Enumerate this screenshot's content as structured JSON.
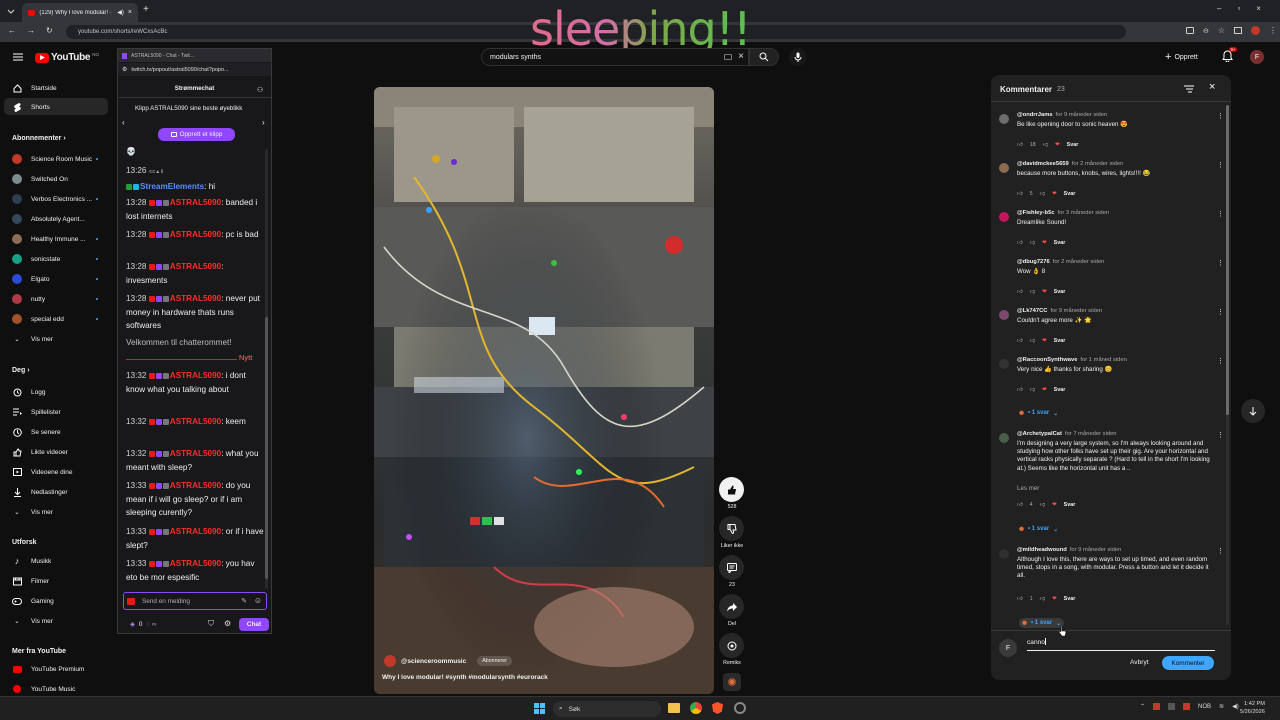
{
  "browser": {
    "tab_title": "(129) Why I love modular! ·",
    "url": "youtube.com/shorts/reWCxsAcBc"
  },
  "overlay_text": "sleeping!!",
  "yt": {
    "logo_text": "YouTube",
    "logo_region": "NO",
    "search_value": "modulars synths",
    "create_label": "Opprett",
    "notification_count": "9+",
    "user_initial": "F"
  },
  "sidebar": {
    "main": [
      {
        "label": "Startside"
      },
      {
        "label": "Shorts"
      }
    ],
    "subs_header": "Abonnementer",
    "subs": [
      {
        "label": "Science Room Music",
        "color": "#c0392b"
      },
      {
        "label": "Switched On",
        "color": "#7f8c8d"
      },
      {
        "label": "Verbos Electronics ...",
        "color": "#2c3e50"
      },
      {
        "label": "Absolutely Agent...",
        "color": "#34495e"
      },
      {
        "label": "Healthy Immune ...",
        "color": "#8e6e53"
      },
      {
        "label": "sonicstate",
        "color": "#16a085"
      },
      {
        "label": "Elgato",
        "color": "#2d4bd8"
      },
      {
        "label": "nutty",
        "color": "#b03a48"
      },
      {
        "label": "special edd",
        "color": "#a0522d"
      }
    ],
    "subs_more": "Vis mer",
    "you_header": "Deg",
    "you": [
      {
        "label": "Logg",
        "icon": "history-icon"
      },
      {
        "label": "Spillelister",
        "icon": "playlist-icon"
      },
      {
        "label": "Se senere",
        "icon": "clock-icon"
      },
      {
        "label": "Likte videoer",
        "icon": "like-icon"
      },
      {
        "label": "Videoene dine",
        "icon": "video-icon"
      },
      {
        "label": "Nedlastinger",
        "icon": "download-icon"
      }
    ],
    "you_more": "Vis mer",
    "explore_header": "Utforsk",
    "explore": [
      {
        "label": "Musikk",
        "icon": "music-icon"
      },
      {
        "label": "Filmer",
        "icon": "film-icon"
      },
      {
        "label": "Gaming",
        "icon": "gaming-icon"
      }
    ],
    "explore_more": "Vis mer",
    "more_header": "Mer fra YouTube",
    "more": [
      {
        "label": "YouTube Premium"
      },
      {
        "label": "YouTube Music"
      }
    ]
  },
  "twitch": {
    "window_title": "ASTRAL5090 - Chat - Twit...",
    "url": "twitch.tv/popout/astral5090/chat?popo...",
    "header": "Strømmechat",
    "clip_text": "Klipp ASTRAL5090 sine beste øyeblikk",
    "clip_button": "Opprett et klipp",
    "messages": [
      {
        "time": "13:26",
        "user": "StreamElements",
        "text": "hi",
        "color": "#5b8cff"
      },
      {
        "time": "13:28",
        "user": "ASTRAL5090",
        "text": "banded i lost internets"
      },
      {
        "time": "13:28",
        "user": "ASTRAL5090",
        "text": "pc is bad"
      },
      {
        "time": "13:28",
        "user": "ASTRAL5090",
        "text": "invesments"
      },
      {
        "time": "13:28",
        "user": "ASTRAL5090",
        "text": "never put money in hardware thats runs softwares"
      },
      {
        "time": "13:32",
        "user": "ASTRAL5090",
        "text": "i dont know what you talking about"
      },
      {
        "time": "13:32",
        "user": "ASTRAL5090",
        "text": "keem"
      },
      {
        "time": "13:32",
        "user": "ASTRAL5090",
        "text": "what you meant with sleep?"
      },
      {
        "time": "13:33",
        "user": "ASTRAL5090",
        "text": "do you mean if i will go sleep? or if i am sleeping curently?"
      },
      {
        "time": "13:33",
        "user": "ASTRAL5090",
        "text": "or if i have slept?"
      },
      {
        "time": "13:33",
        "user": "ASTRAL5090",
        "text": "you hav eto be mor espesific"
      }
    ],
    "welcome": "Velkommen til chatterommet!",
    "new_label": "Nytt",
    "input_placeholder": "Send en melding",
    "points": "0",
    "chat_button": "Chat"
  },
  "short": {
    "channel": "@scienceroommusic",
    "subscribe": "Abonnerer",
    "title": "Why I love modular! #synth #modularsynth #eurorack",
    "likes": "528",
    "dislike_label": "Liker ikke",
    "comments_count": "23",
    "share_label": "Del",
    "remix_label": "Remiks"
  },
  "comments": {
    "title": "Kommentarer",
    "count": "23",
    "items": [
      {
        "author": "@ondrrJams",
        "time": "for 9 måneder siden",
        "text": "Be like opening door to sonic heaven 😍",
        "likes": "18",
        "avcolor": "#6d6d6d"
      },
      {
        "author": "@davidmckee5659",
        "time": "for 2 måneder siden",
        "text": "because more buttons, knobs, wires, lights!!!! 😂",
        "likes": "5",
        "avcolor": "#8b6a4f"
      },
      {
        "author": "@Fishley-b5c",
        "time": "for 3 måneder siden",
        "text": "Dreamlike Sound!",
        "likes": "",
        "avcolor": "#c2185b"
      },
      {
        "author": "@dbug7276",
        "time": "for 2 måneder siden",
        "text": "Wow 👌 8",
        "likes": "",
        "avcolor": "#222222"
      },
      {
        "author": "@Lk747CC",
        "time": "for 9 måneder siden",
        "text": "Couldn't agree more ✨ 🌟",
        "likes": "",
        "avcolor": "#7b4a6e"
      },
      {
        "author": "@RaccoonSynthwave",
        "time": "for 1 måned siden",
        "text": "Very nice 👍 thanks for sharing 😊",
        "likes": "",
        "avcolor": "#333333",
        "replies": "• 1 svar"
      },
      {
        "author": "@ArchetypalCat",
        "time": "for 7 måneder siden",
        "text": "I'm designing a very large system, so I'm always looking around and studying how other folks have set up their gig. Are your horizontal and vertical racks physically separate ? (Hard to tell in the short I'm looking at.) Seems like the horizontal unit has a ..",
        "read_more": "Les mer",
        "likes": "4",
        "avcolor": "#4a5d4a",
        "replies": "• 1 svar"
      },
      {
        "author": "@mildheadwound",
        "time": "for 9 måneder siden",
        "text": "Although I love this, there are ways to set up timed, and even random timed, stops in a song, with modular. Press a button and let it decide it all.",
        "likes": "1",
        "avcolor": "#2e2e2e",
        "replies": "• 1 svar"
      }
    ],
    "reply_label": "Svar",
    "input_value": "canno",
    "user_initial": "F",
    "cancel": "Avbryt",
    "submit": "Kommenter"
  },
  "taskbar": {
    "search": "Søk",
    "lang": "NOB",
    "time": "1:42 PM",
    "date": "5/26/2026"
  }
}
